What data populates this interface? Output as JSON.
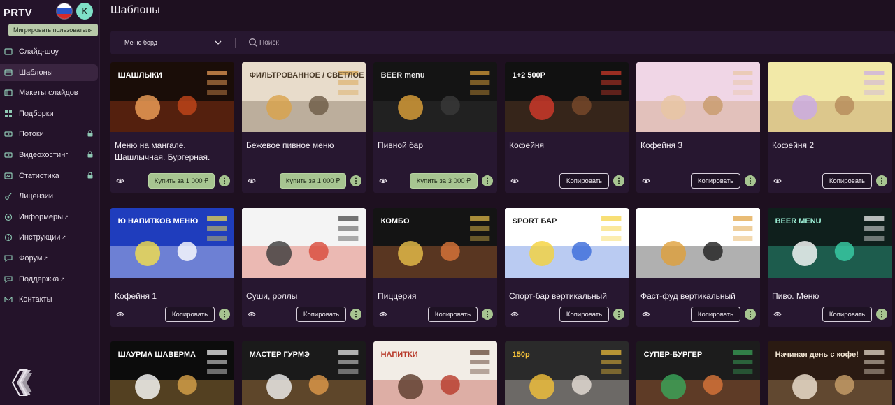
{
  "app": {
    "brand": "PRTV",
    "avatar_letter": "K",
    "migrate_label": "Мигрировать пользователя"
  },
  "page": {
    "title": "Шаблоны"
  },
  "filters": {
    "select_value": "Меню борд",
    "search_placeholder": "Поиск"
  },
  "sidebar": {
    "items": [
      {
        "label": "Слайд-шоу",
        "icon": "slideshow-icon",
        "locked": false,
        "external": false
      },
      {
        "label": "Шаблоны",
        "icon": "templates-icon",
        "locked": false,
        "external": false,
        "active": true
      },
      {
        "label": "Макеты слайдов",
        "icon": "layouts-icon",
        "locked": false,
        "external": false
      },
      {
        "label": "Подборки",
        "icon": "collections-icon",
        "locked": false,
        "external": false
      },
      {
        "label": "Потоки",
        "icon": "streams-icon",
        "locked": true,
        "external": false
      },
      {
        "label": "Видеохостинг",
        "icon": "video-icon",
        "locked": true,
        "external": false
      },
      {
        "label": "Статистика",
        "icon": "stats-icon",
        "locked": true,
        "external": false
      },
      {
        "label": "Лицензии",
        "icon": "key-icon",
        "locked": false,
        "external": false
      },
      {
        "label": "Информеры",
        "icon": "informer-icon",
        "locked": false,
        "external": true
      },
      {
        "label": "Инструкции",
        "icon": "instructions-icon",
        "locked": false,
        "external": true
      },
      {
        "label": "Форум",
        "icon": "forum-icon",
        "locked": false,
        "external": true
      },
      {
        "label": "Поддержка",
        "icon": "support-icon",
        "locked": false,
        "external": true
      },
      {
        "label": "Контакты",
        "icon": "contacts-icon",
        "locked": false,
        "external": false
      }
    ]
  },
  "cards": [
    {
      "title": "Меню на мангале. Шашлычная. Бургерная.",
      "action": "Купить за 1 000 ₽",
      "kind": "buy",
      "thumb_text": "ШАШЛЫКИ"
    },
    {
      "title": "Бежевое пивное меню",
      "action": "Купить за 1 000 ₽",
      "kind": "buy",
      "thumb_text": "ФИЛЬТРОВАННОЕ / СВЕТЛОЕ"
    },
    {
      "title": "Пивной бар",
      "action": "Купить за 3 000 ₽",
      "kind": "buy",
      "thumb_text": "BEER menu"
    },
    {
      "title": "Кофейня",
      "action": "Копировать",
      "kind": "copy",
      "thumb_text": "1+2 500Р"
    },
    {
      "title": "Кофейня 3",
      "action": "Копировать",
      "kind": "copy",
      "thumb_text": ""
    },
    {
      "title": "Кофейня 2",
      "action": "Копировать",
      "kind": "copy",
      "thumb_text": ""
    },
    {
      "title": "Кофейня 1",
      "action": "Копировать",
      "kind": "copy",
      "thumb_text": "Ю НАПИТКОВ МЕНЮ"
    },
    {
      "title": "Суши, роллы",
      "action": "Копировать",
      "kind": "copy",
      "thumb_text": ""
    },
    {
      "title": "Пиццерия",
      "action": "Копировать",
      "kind": "copy",
      "thumb_text": "КОМБО"
    },
    {
      "title": "Спорт-бар вертикальный",
      "action": "Копировать",
      "kind": "copy",
      "thumb_text": "SPORT БАР"
    },
    {
      "title": "Фаст-фуд вертикальный",
      "action": "Копировать",
      "kind": "copy",
      "thumb_text": ""
    },
    {
      "title": "Пиво. Меню",
      "action": "Копировать",
      "kind": "copy",
      "thumb_text": "BEER MENU"
    },
    {
      "title": "",
      "action": "",
      "kind": "none",
      "thumb_text": "ШАУРМА ШАВЕРМА"
    },
    {
      "title": "",
      "action": "",
      "kind": "none",
      "thumb_text": "МАСТЕР ГУРМЭ"
    },
    {
      "title": "",
      "action": "",
      "kind": "none",
      "thumb_text": "НАПИТКИ"
    },
    {
      "title": "",
      "action": "",
      "kind": "none",
      "thumb_text": "150р"
    },
    {
      "title": "",
      "action": "",
      "kind": "none",
      "thumb_text": "СУПЕР-БУРГЕР"
    },
    {
      "title": "",
      "action": "",
      "kind": "none",
      "thumb_text": "Начиная день с кофе!"
    }
  ],
  "colors": {
    "accent": "#a7c591",
    "bg": "#1e1020",
    "card": "#271730",
    "sidebar": "#24132a"
  }
}
